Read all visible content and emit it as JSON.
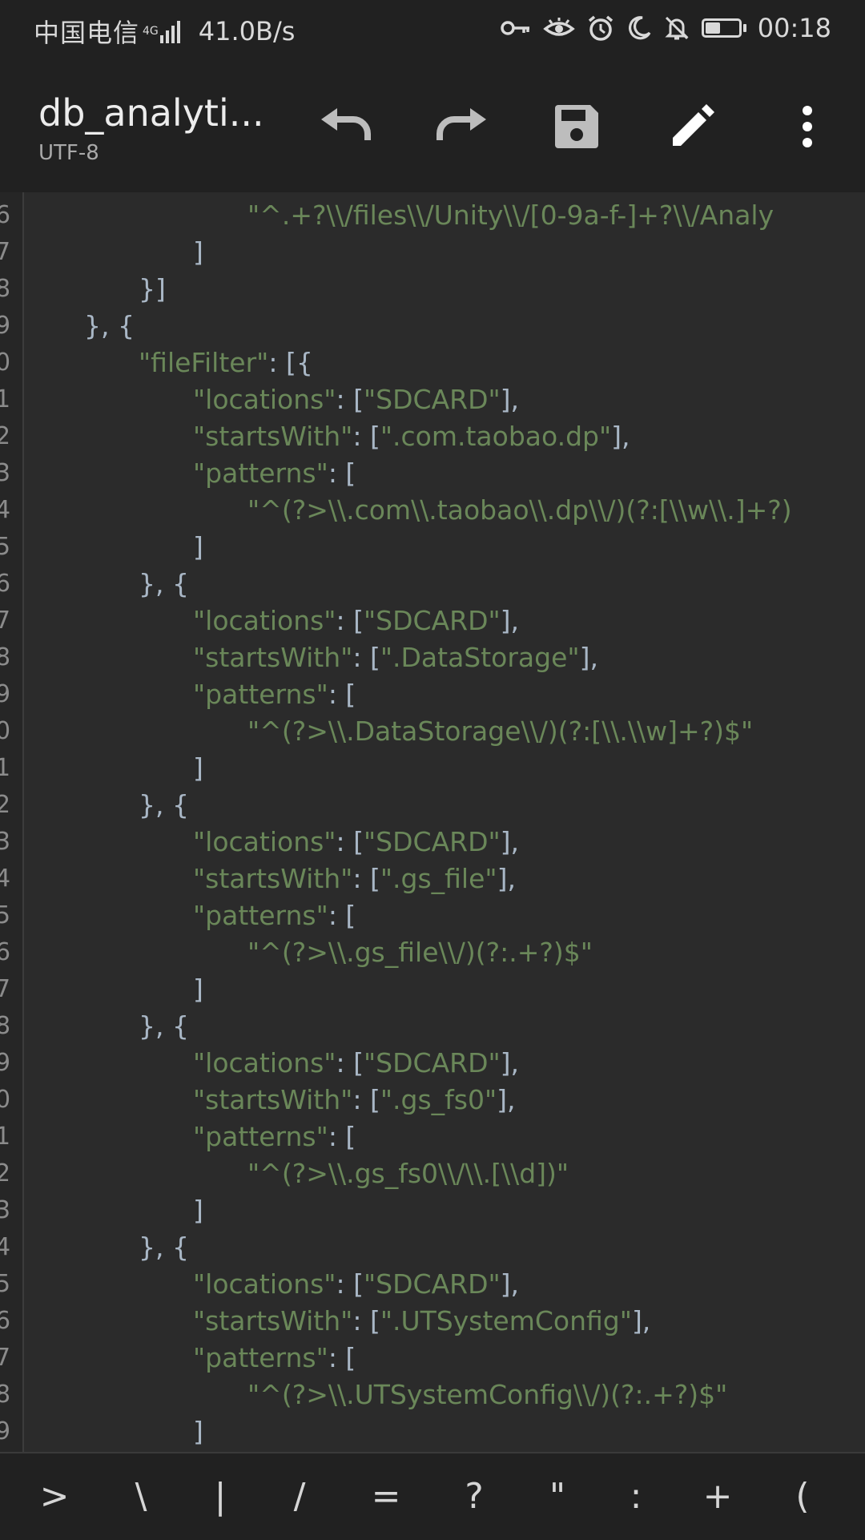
{
  "status_bar": {
    "carrier": "中国电信",
    "network": "4G",
    "speed": "41.0B/s",
    "battery_level": 0.45,
    "time": "00:18"
  },
  "toolbar": {
    "title": "db_analyti...",
    "encoding": "UTF-8",
    "icons": [
      "undo-icon",
      "redo-icon",
      "save-icon",
      "edit-icon",
      "more-icon"
    ]
  },
  "editor": {
    "lines": [
      {
        "num": "6",
        "indent": 4,
        "parts": [
          {
            "t": "\"^.+?\\\\/files\\\\/Unity\\\\/[0-9a-f-]+?\\\\/Analy",
            "c": "str"
          }
        ]
      },
      {
        "num": "7",
        "indent": 3,
        "parts": [
          {
            "t": "]",
            "c": "pun"
          }
        ]
      },
      {
        "num": "8",
        "indent": 2,
        "parts": [
          {
            "t": "}]",
            "c": "pun"
          }
        ]
      },
      {
        "num": "9",
        "indent": 1,
        "parts": [
          {
            "t": "}, {",
            "c": "pun"
          }
        ]
      },
      {
        "num": "0",
        "indent": 2,
        "parts": [
          {
            "t": "\"fileFilter\"",
            "c": "str"
          },
          {
            "t": ": [{",
            "c": "pun"
          }
        ]
      },
      {
        "num": "1",
        "indent": 3,
        "parts": [
          {
            "t": "\"locations\"",
            "c": "str"
          },
          {
            "t": ": [",
            "c": "pun"
          },
          {
            "t": "\"SDCARD\"",
            "c": "str"
          },
          {
            "t": "],",
            "c": "pun"
          }
        ]
      },
      {
        "num": "2",
        "indent": 3,
        "parts": [
          {
            "t": "\"startsWith\"",
            "c": "str"
          },
          {
            "t": ": [",
            "c": "pun"
          },
          {
            "t": "\".com.taobao.dp\"",
            "c": "str"
          },
          {
            "t": "],",
            "c": "pun"
          }
        ]
      },
      {
        "num": "3",
        "indent": 3,
        "parts": [
          {
            "t": "\"patterns\"",
            "c": "str"
          },
          {
            "t": ": [",
            "c": "pun"
          }
        ]
      },
      {
        "num": "4",
        "indent": 4,
        "parts": [
          {
            "t": "\"^(?>\\\\.com\\\\.taobao\\\\.dp\\\\/)(?:[\\\\w\\\\.]+?)",
            "c": "str"
          }
        ]
      },
      {
        "num": "5",
        "indent": 3,
        "parts": [
          {
            "t": "]",
            "c": "pun"
          }
        ]
      },
      {
        "num": "6",
        "indent": 2,
        "parts": [
          {
            "t": "}, {",
            "c": "pun"
          }
        ]
      },
      {
        "num": "7",
        "indent": 3,
        "parts": [
          {
            "t": "\"locations\"",
            "c": "str"
          },
          {
            "t": ": [",
            "c": "pun"
          },
          {
            "t": "\"SDCARD\"",
            "c": "str"
          },
          {
            "t": "],",
            "c": "pun"
          }
        ]
      },
      {
        "num": "8",
        "indent": 3,
        "parts": [
          {
            "t": "\"startsWith\"",
            "c": "str"
          },
          {
            "t": ": [",
            "c": "pun"
          },
          {
            "t": "\".DataStorage\"",
            "c": "str"
          },
          {
            "t": "],",
            "c": "pun"
          }
        ]
      },
      {
        "num": "9",
        "indent": 3,
        "parts": [
          {
            "t": "\"patterns\"",
            "c": "str"
          },
          {
            "t": ": [",
            "c": "pun"
          }
        ]
      },
      {
        "num": "0",
        "indent": 4,
        "parts": [
          {
            "t": "\"^(?>\\\\.DataStorage\\\\/)(?:[\\\\.\\\\w]+?)$\"",
            "c": "str"
          }
        ]
      },
      {
        "num": "1",
        "indent": 3,
        "parts": [
          {
            "t": "]",
            "c": "pun"
          }
        ]
      },
      {
        "num": "2",
        "indent": 2,
        "parts": [
          {
            "t": "}, {",
            "c": "pun"
          }
        ]
      },
      {
        "num": "3",
        "indent": 3,
        "parts": [
          {
            "t": "\"locations\"",
            "c": "str"
          },
          {
            "t": ": [",
            "c": "pun"
          },
          {
            "t": "\"SDCARD\"",
            "c": "str"
          },
          {
            "t": "],",
            "c": "pun"
          }
        ]
      },
      {
        "num": "4",
        "indent": 3,
        "parts": [
          {
            "t": "\"startsWith\"",
            "c": "str"
          },
          {
            "t": ": [",
            "c": "pun"
          },
          {
            "t": "\".gs_file\"",
            "c": "str"
          },
          {
            "t": "],",
            "c": "pun"
          }
        ]
      },
      {
        "num": "5",
        "indent": 3,
        "parts": [
          {
            "t": "\"patterns\"",
            "c": "str"
          },
          {
            "t": ": [",
            "c": "pun"
          }
        ]
      },
      {
        "num": "6",
        "indent": 4,
        "parts": [
          {
            "t": "\"^(?>\\\\.gs_file\\\\/)(?:.+?)$\"",
            "c": "str"
          }
        ]
      },
      {
        "num": "7",
        "indent": 3,
        "parts": [
          {
            "t": "]",
            "c": "pun"
          }
        ]
      },
      {
        "num": "8",
        "indent": 2,
        "parts": [
          {
            "t": "}, {",
            "c": "pun"
          }
        ]
      },
      {
        "num": "9",
        "indent": 3,
        "parts": [
          {
            "t": "\"locations\"",
            "c": "str"
          },
          {
            "t": ": [",
            "c": "pun"
          },
          {
            "t": "\"SDCARD\"",
            "c": "str"
          },
          {
            "t": "],",
            "c": "pun"
          }
        ]
      },
      {
        "num": "0",
        "indent": 3,
        "parts": [
          {
            "t": "\"startsWith\"",
            "c": "str"
          },
          {
            "t": ": [",
            "c": "pun"
          },
          {
            "t": "\".gs_fs0\"",
            "c": "str"
          },
          {
            "t": "],",
            "c": "pun"
          }
        ]
      },
      {
        "num": "1",
        "indent": 3,
        "parts": [
          {
            "t": "\"patterns\"",
            "c": "str"
          },
          {
            "t": ": [",
            "c": "pun"
          }
        ]
      },
      {
        "num": "2",
        "indent": 4,
        "parts": [
          {
            "t": "\"^(?>\\\\.gs_fs0\\\\/\\\\.[\\\\d])\"",
            "c": "str"
          }
        ]
      },
      {
        "num": "3",
        "indent": 3,
        "parts": [
          {
            "t": "]",
            "c": "pun"
          }
        ]
      },
      {
        "num": "4",
        "indent": 2,
        "parts": [
          {
            "t": "}, {",
            "c": "pun"
          }
        ]
      },
      {
        "num": "5",
        "indent": 3,
        "parts": [
          {
            "t": "\"locations\"",
            "c": "str"
          },
          {
            "t": ": [",
            "c": "pun"
          },
          {
            "t": "\"SDCARD\"",
            "c": "str"
          },
          {
            "t": "],",
            "c": "pun"
          }
        ]
      },
      {
        "num": "6",
        "indent": 3,
        "parts": [
          {
            "t": "\"startsWith\"",
            "c": "str"
          },
          {
            "t": ": [",
            "c": "pun"
          },
          {
            "t": "\".UTSystemConfig\"",
            "c": "str"
          },
          {
            "t": "],",
            "c": "pun"
          }
        ]
      },
      {
        "num": "7",
        "indent": 3,
        "parts": [
          {
            "t": "\"patterns\"",
            "c": "str"
          },
          {
            "t": ": [",
            "c": "pun"
          }
        ]
      },
      {
        "num": "8",
        "indent": 4,
        "parts": [
          {
            "t": "\"^(?>\\\\.UTSystemConfig\\\\/)(?:.+?)$\"",
            "c": "str"
          }
        ]
      },
      {
        "num": "9",
        "indent": 3,
        "parts": [
          {
            "t": "]",
            "c": "pun"
          }
        ]
      },
      {
        "num": "",
        "indent": 2,
        "parts": [
          {
            "t": "}, {",
            "c": "pun"
          }
        ]
      }
    ]
  },
  "keybar": {
    "keys": [
      ">",
      "\\",
      "|",
      "/",
      "=",
      "?",
      "\"",
      ":",
      "+",
      "("
    ]
  },
  "colors": {
    "string": "#6a8759",
    "punctuation": "#a9b7c6",
    "background": "#2b2b2b",
    "toolbar": "#212121"
  }
}
